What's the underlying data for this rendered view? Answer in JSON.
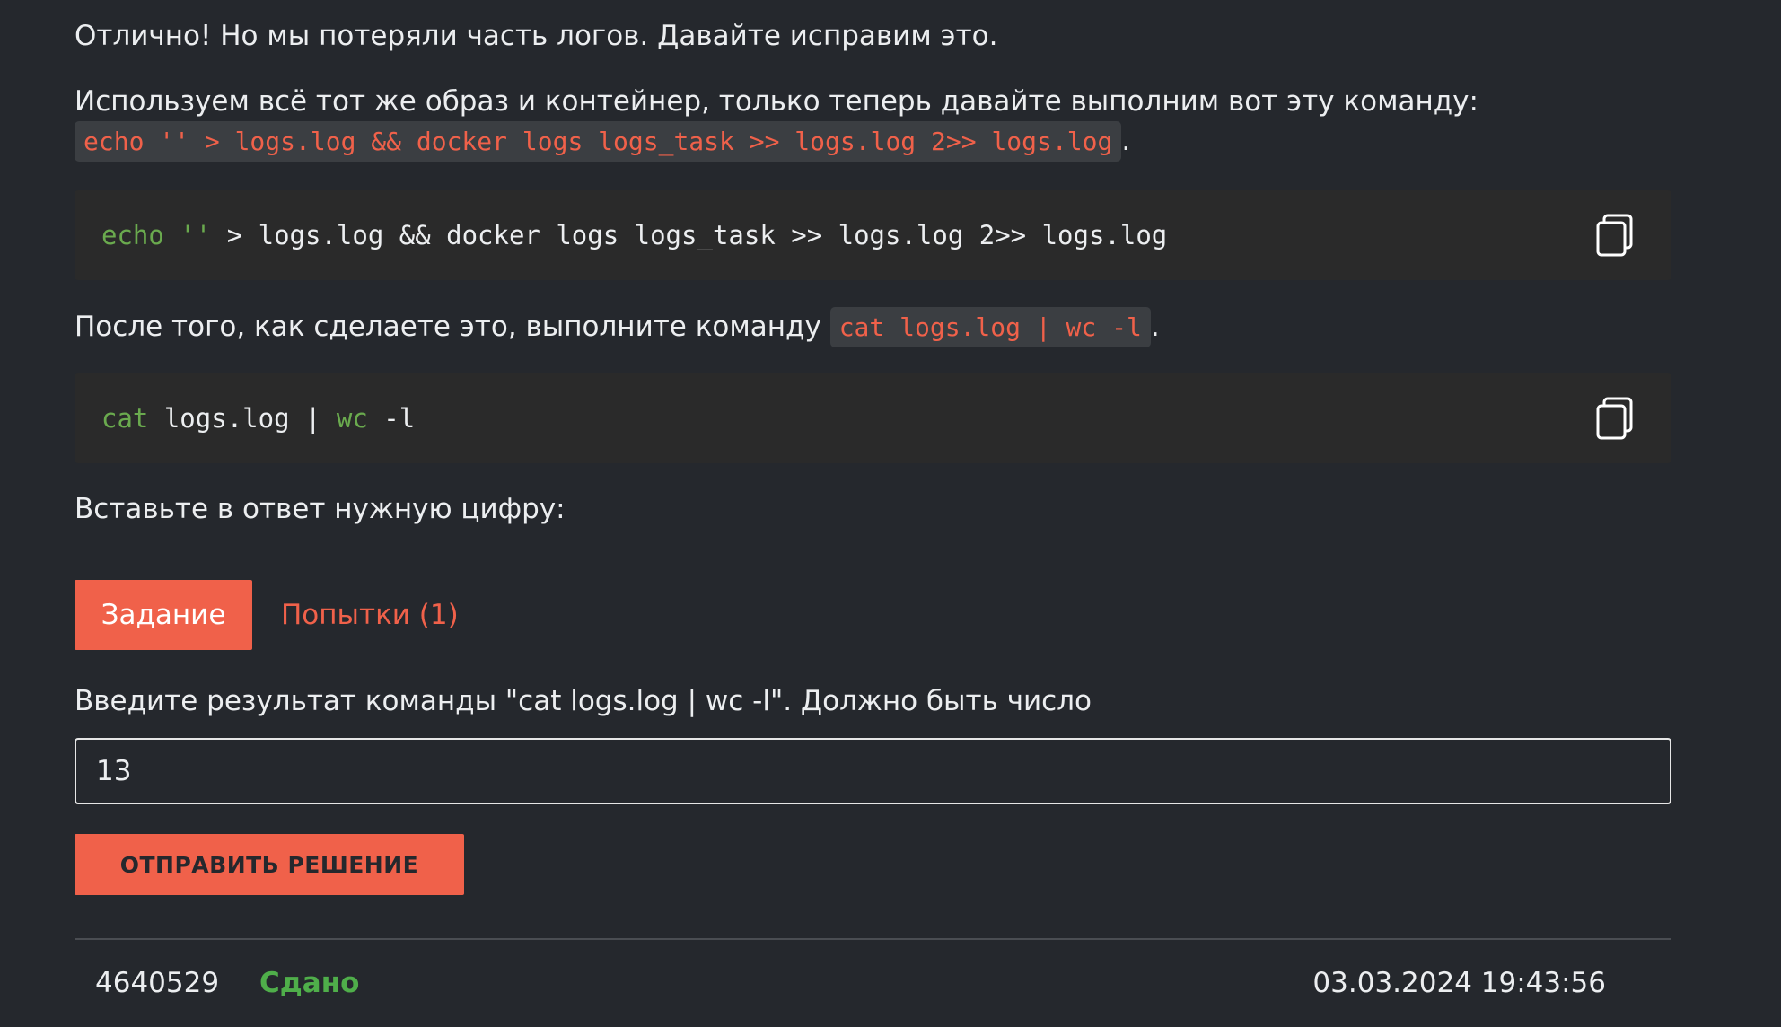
{
  "paragraphs": {
    "intro": "Отлично! Но мы потеряли часть логов. Давайте исправим это.",
    "instruction_prefix": "Используем всё тот же образ и контейнер, только теперь давайте выполним вот эту команду:",
    "instruction_code": "echo '' > logs.log && docker logs logs_task >> logs.log 2>> logs.log",
    "instruction_suffix": ".",
    "after_prefix": "После того, как сделаете это, выполните команду",
    "after_code": "cat logs.log | wc -l",
    "after_suffix": ".",
    "insert_answer": "Вставьте в ответ нужную цифру:"
  },
  "code_blocks": [
    {
      "cmd": "echo",
      "str": " ''",
      "rest": " > logs.log && docker logs logs_task >> logs.log 2>> logs.log"
    },
    {
      "cmd": "cat",
      "mid": " logs.log | ",
      "cmd2": "wc",
      "rest": " -l"
    }
  ],
  "tabs": {
    "task": "Задание",
    "attempts": "Попытки (1)"
  },
  "form": {
    "prompt": "Введите результат команды \"cat logs.log | wc -l\". Должно быть число",
    "value": "13",
    "submit_label": "ОТПРАВИТЬ РЕШЕНИЕ"
  },
  "submission": {
    "id": "4640529",
    "status": "Сдано",
    "date": "03.03.2024 19:43:56"
  },
  "icons": {
    "copy": "copy-icon"
  },
  "colors": {
    "background": "#25282d",
    "accent": "#f0614a",
    "success": "#4fae4a",
    "code_bg": "#2a2a2a",
    "inline_code_bg": "#3b3e42"
  }
}
